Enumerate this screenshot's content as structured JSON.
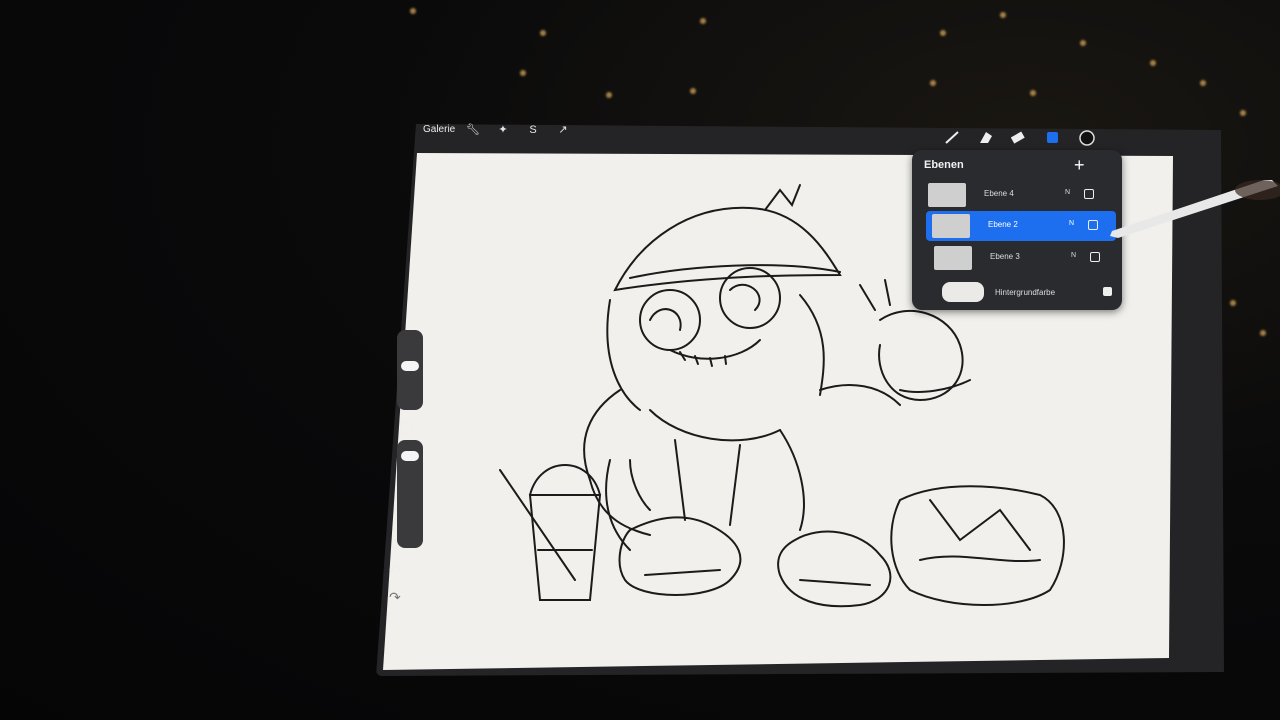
{
  "toolbar": {
    "gallery_label": "Galerie",
    "left_icons": [
      "wrench-icon",
      "magic-wand-icon",
      "selection-icon",
      "transform-arrow-icon"
    ],
    "right_icons": [
      "brush-icon",
      "smudge-icon",
      "eraser-icon",
      "layers-icon",
      "color-circle-icon"
    ]
  },
  "layers_panel": {
    "title": "Ebenen",
    "add_label": "+",
    "layers": [
      {
        "name": "Ebene 4",
        "mode": "N",
        "visible": true,
        "active": false
      },
      {
        "name": "Ebene 2",
        "mode": "N",
        "visible": true,
        "active": true
      },
      {
        "name": "Ebene 3",
        "mode": "N",
        "visible": true,
        "active": false
      }
    ],
    "background": {
      "name": "Hintergrundfarbe",
      "visible": true
    }
  },
  "sidebar": {
    "icons": [
      "undo-icon",
      "redo-icon",
      "modify-square-icon"
    ]
  },
  "colors": {
    "accent": "#1e6ff0",
    "canvas": "#f1f0ec",
    "ui_dark": "#242426"
  }
}
